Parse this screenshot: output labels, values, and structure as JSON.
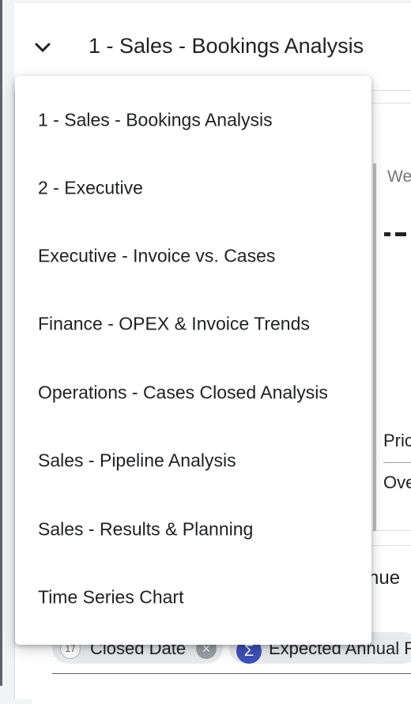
{
  "header": {
    "title": "1 - Sales - Bookings Analysis"
  },
  "background": {
    "we_fragment": "We",
    "price_fragment": "Pric",
    "over_fragment": "Ove",
    "revenue_fragment": "nue",
    "chips": [
      {
        "icon": "calendar-icon",
        "icon_text": "17",
        "label": "Closed Date",
        "remove": "×"
      },
      {
        "icon": "sigma-icon",
        "icon_text": "Σ",
        "label": "Expected Annual R"
      }
    ]
  },
  "menu": {
    "items": [
      {
        "label": "1 - Sales - Bookings Analysis"
      },
      {
        "label": "2 - Executive"
      },
      {
        "label": "Executive - Invoice vs. Cases"
      },
      {
        "label": "Finance - OPEX & Invoice Trends"
      },
      {
        "label": "Operations - Cases Closed Analysis"
      },
      {
        "label": "Sales - Pipeline Analysis"
      },
      {
        "label": "Sales - Results & Planning"
      },
      {
        "label": "Time Series Chart"
      }
    ]
  }
}
